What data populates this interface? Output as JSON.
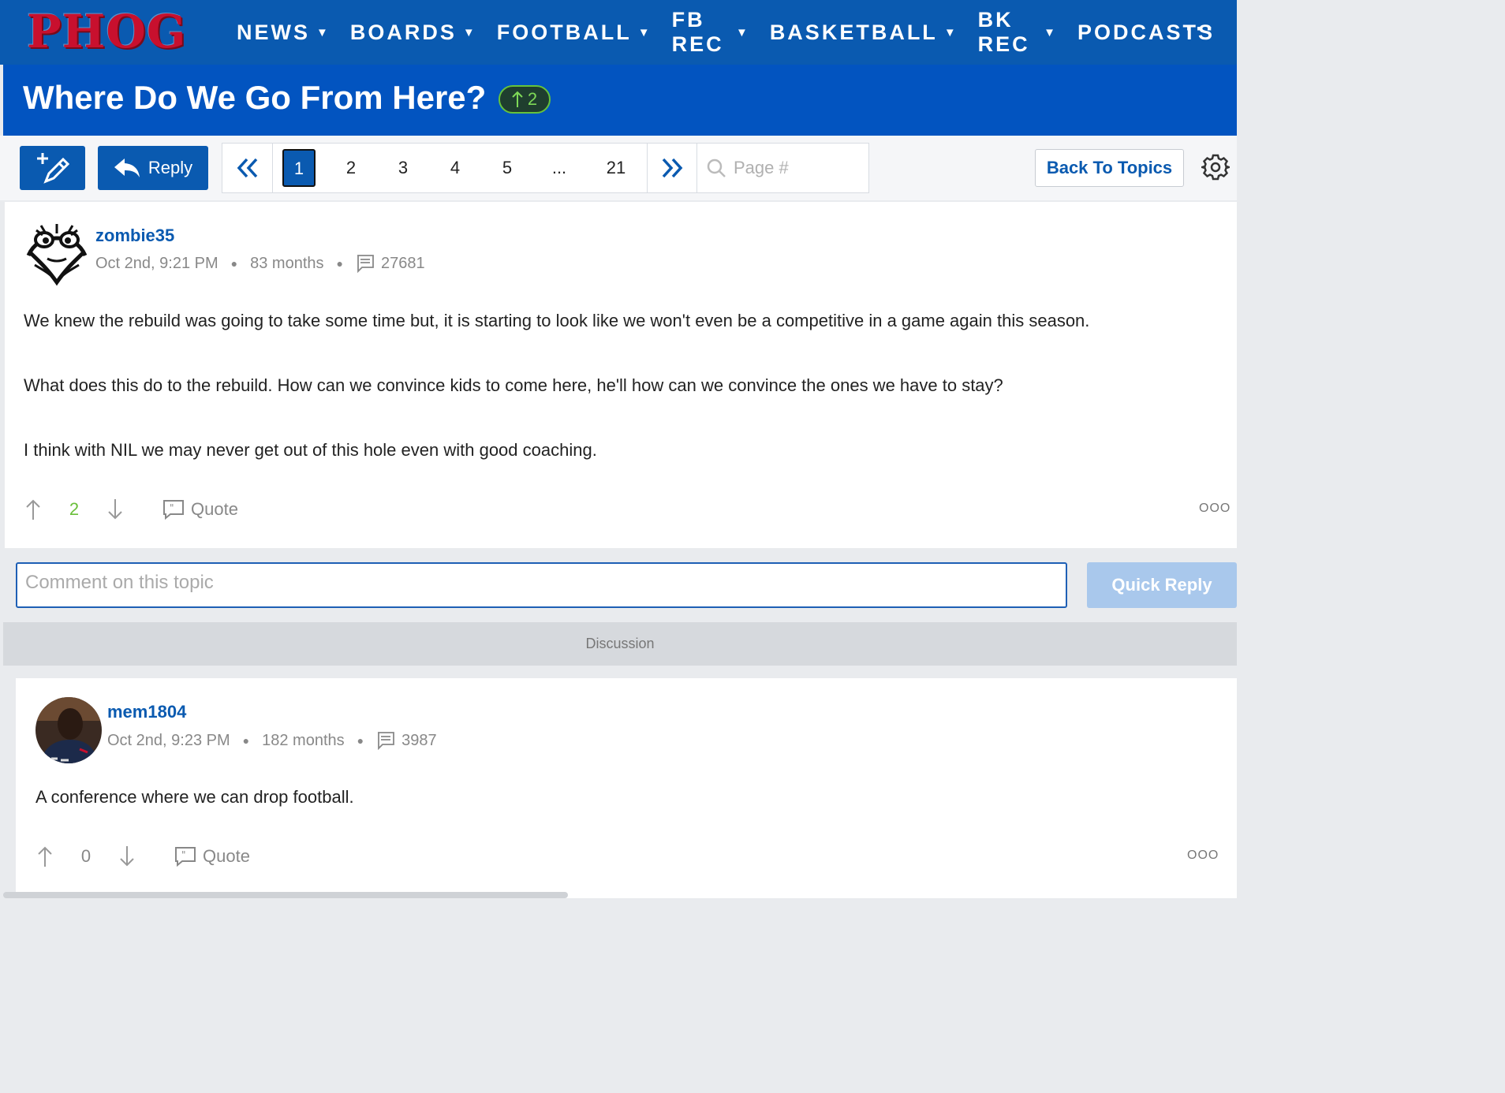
{
  "nav": {
    "logo": "PHOG",
    "items": [
      {
        "label": "NEWS"
      },
      {
        "label": "BOARDS"
      },
      {
        "label": "FOOTBALL"
      },
      {
        "label": "FB REC"
      },
      {
        "label": "BASKETBALL"
      },
      {
        "label": "BK REC"
      },
      {
        "label": "PODCASTS"
      }
    ],
    "more": "···"
  },
  "topic": {
    "title": "Where Do We Go From Here?",
    "votes": "2"
  },
  "toolbar": {
    "reply_label": "Reply",
    "pages": [
      "1",
      "2",
      "3",
      "4",
      "5",
      "...",
      "21"
    ],
    "current_page": "1",
    "page_search_placeholder": "Page #",
    "back_label": "Back To Topics"
  },
  "posts": [
    {
      "username": "zombie35",
      "date": "Oct 2nd, 9:21 PM",
      "tenure": "83 months",
      "post_count": "27681",
      "paragraphs": [
        "We knew the rebuild was going to take some time but, it is starting to look like we won't even be a competitive in a game again this season.",
        "What does this do to the rebuild. How can we convince kids to come here, he'll how can we convince the ones we have to stay?",
        "I think with NIL we may never get out of this hole even with good coaching."
      ],
      "votes": "2",
      "quote_label": "Quote",
      "vote_color": "#6abf3a"
    },
    {
      "username": "mem1804",
      "date": "Oct 2nd, 9:23 PM",
      "tenure": "182 months",
      "post_count": "3987",
      "paragraphs": [
        "A conference where we can drop football."
      ],
      "votes": "0",
      "quote_label": "Quote"
    }
  ],
  "quick_reply": {
    "placeholder": "Comment on this topic",
    "button_label": "Quick Reply"
  },
  "section_label": "Discussion",
  "colors": {
    "nav_bg": "#0a5ab0",
    "title_bg": "#0254c0",
    "logo": "#c8102e",
    "link": "#0a5ab0",
    "quick_reply_btn": "#a9c8ec"
  }
}
